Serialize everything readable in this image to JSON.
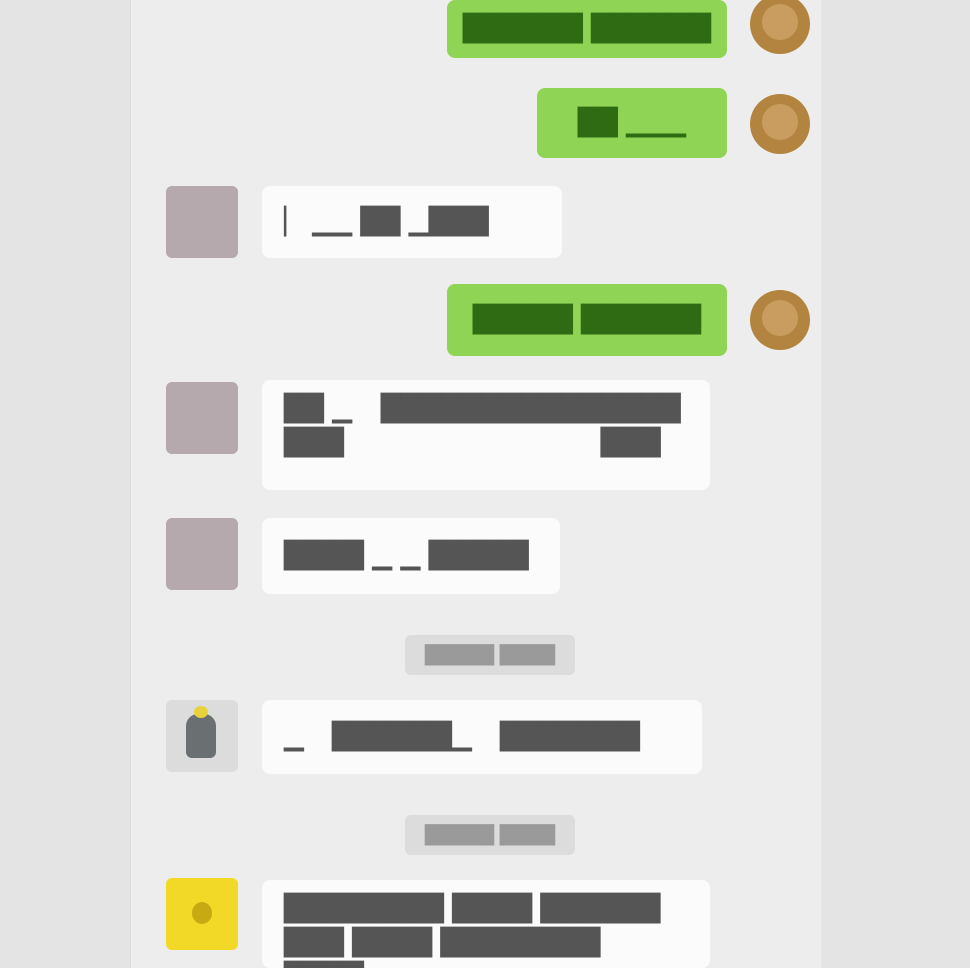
{
  "colors": {
    "page_bg": "#e4e4e4",
    "chat_bg": "#ededed",
    "outgoing_bubble": "#8fd455",
    "incoming_bubble": "#fbfbfb",
    "my_avatar": "#b3843f",
    "friend_avatar": "#b5a9ae",
    "group_avatar": "#f2d927"
  },
  "messages": [
    {
      "dir": "out",
      "text": "██████ ██████"
    },
    {
      "dir": "out",
      "text": "██ ▁▁▁"
    },
    {
      "dir": "in",
      "text": "▏ ▁▁ ██ ▁███"
    },
    {
      "dir": "out",
      "text": "█████ ██████"
    },
    {
      "dir": "in",
      "text_a": "██ ▁ ███",
      "text_b": "████ ███",
      "text_c": "███████████"
    },
    {
      "dir": "in",
      "text": "████ ▁ ▁ █████"
    },
    {
      "dir": "in",
      "text_a": "▁",
      "text_b": "██████▁",
      "text_c": "███████"
    },
    {
      "dir": "in",
      "text": "████████ ████ ██████ ███ ████ ████████ ████"
    }
  ],
  "timestamps": [
    "█████ ████",
    "█████ ████"
  ],
  "icons": {
    "me": "user-avatar-icon",
    "friend": "friend-avatar-icon",
    "bot": "figure-avatar-icon",
    "group": "yellow-group-avatar-icon"
  }
}
